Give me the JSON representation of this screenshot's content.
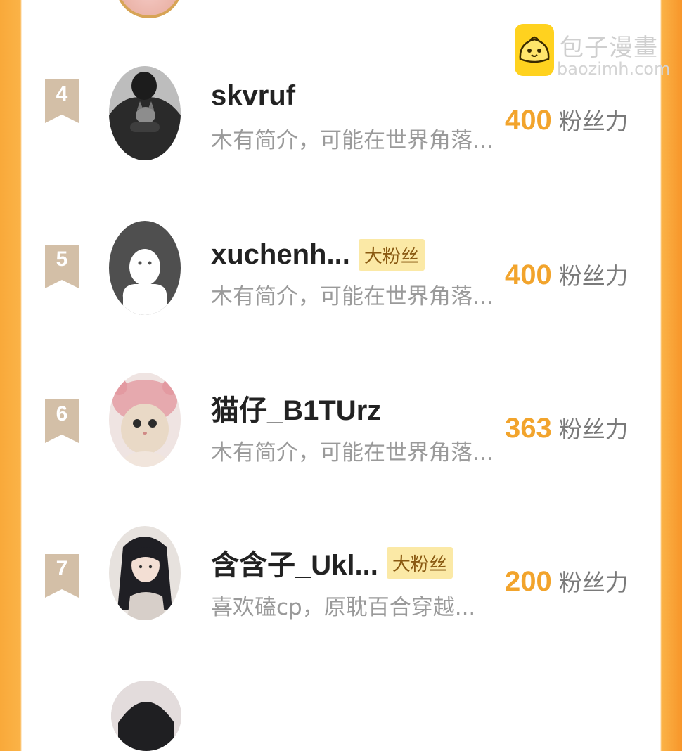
{
  "watermark": {
    "title": "包子漫畫",
    "domain": "baozimh.com"
  },
  "fans": [
    {
      "rank": "4",
      "username": "skvruf",
      "tag": "",
      "bio": "木有简介，可能在世界角落...",
      "power": "400",
      "power_label": "粉丝力",
      "avatar": "photo-person-cat"
    },
    {
      "rank": "5",
      "username": "xuchenh...",
      "tag": "大粉丝",
      "bio": "木有简介，可能在世界角落...",
      "power": "400",
      "power_label": "粉丝力",
      "avatar": "default-ghost-avatar"
    },
    {
      "rank": "6",
      "username": "猫仔_B1TUrz",
      "tag": "",
      "bio": "木有简介，可能在世界角落...",
      "power": "363",
      "power_label": "粉丝力",
      "avatar": "kitten-pink-hat"
    },
    {
      "rank": "7",
      "username": "含含子_Ukl...",
      "tag": "大粉丝",
      "bio": "喜欢磕cp，原耽百合穿越...",
      "power": "200",
      "power_label": "粉丝力",
      "avatar": "anime-girl"
    }
  ],
  "colors": {
    "accent_orange": "#f2a42c",
    "border_orange": "#f9a93a",
    "rank_badge": "#d3bfa7",
    "tag_bg": "#fbe9a6"
  }
}
